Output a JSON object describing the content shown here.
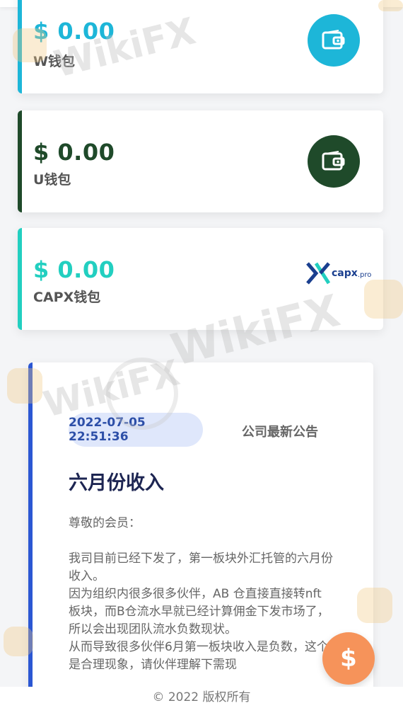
{
  "wallets": [
    {
      "amount": "$ 0.00",
      "label": "W钱包",
      "color": "#1db6d8",
      "icon": "wallet-icon"
    },
    {
      "amount": "$ 0.00",
      "label": "U钱包",
      "color": "#1f4a2a",
      "icon": "wallet-icon"
    },
    {
      "amount": "$ 0.00",
      "label": "CAPX钱包",
      "color": "#22cfc0",
      "logo_text": "capx",
      "logo_suffix": ".pro"
    }
  ],
  "notice": {
    "datetime": "2022-07-05 22:51:36",
    "header_label": "公司最新公告",
    "title": "六月份收入",
    "body": [
      "尊敬的会员：",
      "",
      "我司目前已经下发了，第一板块外汇托管的六月份收入。",
      "因为组织内很多很多伙伴，AB 仓直接直接转nft 板块，而B仓流水早就已经计算佣金下发市场了，所以会出现团队流水负数现状。",
      "从而导致很多伙伴6月第一板块收入是负数，这个是合理现象，请伙伴理解下需现"
    ],
    "accent_color": "#2b57d3"
  },
  "fab": {
    "symbol": "$",
    "color": "#f6935a"
  },
  "footer": {
    "text": "© 2022 版权所有"
  },
  "watermark": {
    "text": "WikiFX"
  }
}
